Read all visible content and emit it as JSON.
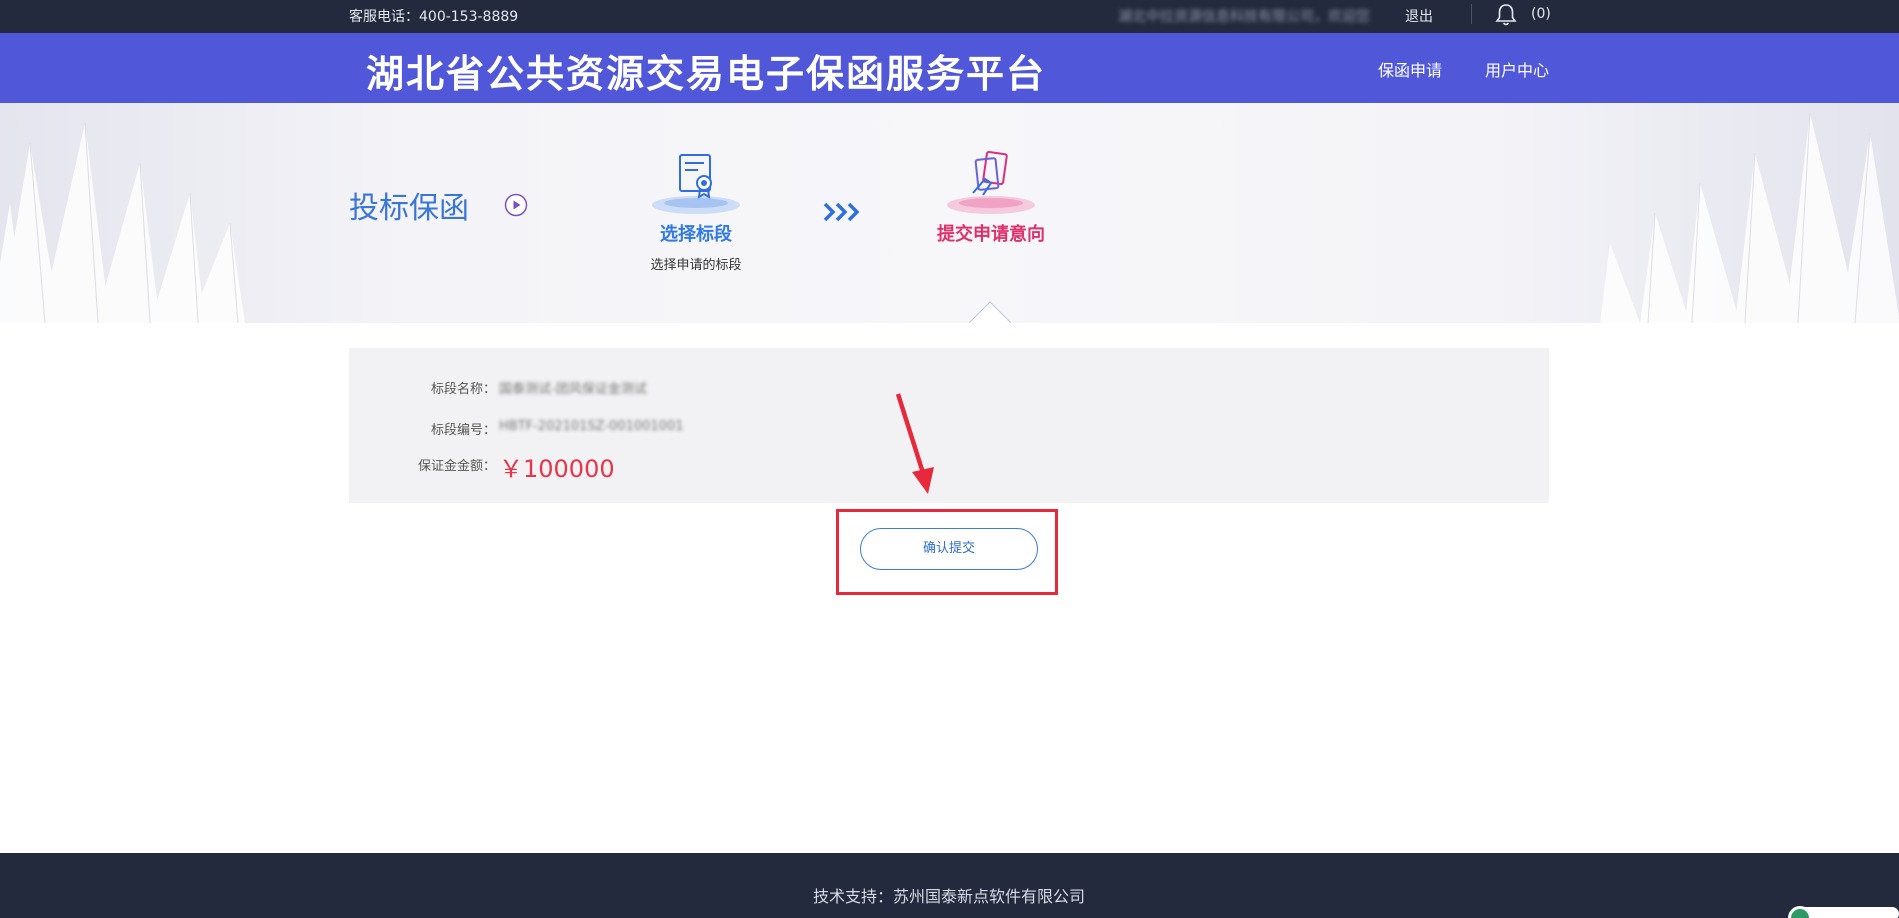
{
  "topbar": {
    "phone": "客服电话：400-153-8889",
    "welcome": "湖北中拉资源信息科技有限公司，欢迎您",
    "logout": "退出",
    "notification_count": "(0)"
  },
  "header": {
    "title": "湖北省公共资源交易电子保函服务平台",
    "nav": {
      "apply": "保函申请",
      "user_center": "用户中心"
    }
  },
  "banner": {
    "section_title": "投标保函",
    "steps": [
      {
        "label": "选择标段",
        "sub": "选择申请的标段"
      },
      {
        "label": "提交申请意向",
        "sub": ""
      }
    ]
  },
  "info": {
    "rows": [
      {
        "key": "标段名称：",
        "value": "国泰测试-团风保证金测试"
      },
      {
        "key": "标段编号：",
        "value": "HBTF-202101SZ-001001001"
      },
      {
        "key": "保证金金额：",
        "value": "￥100000"
      }
    ]
  },
  "confirm": {
    "label": "确认提交"
  },
  "footer": {
    "support": "技术支持：苏州国泰新点软件有限公司"
  },
  "colors": {
    "header_bg": "#5058d9",
    "topbar_bg": "#232a3e",
    "step_active": "#e0306a",
    "step_done": "#2f7ae5",
    "amount": "#e8354a",
    "highlight": "#e8293c"
  }
}
